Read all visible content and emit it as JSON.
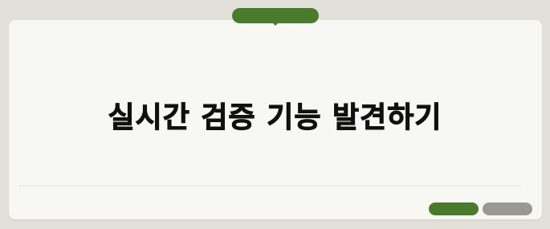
{
  "title": "실시간 검증 기능 발견하기",
  "colors": {
    "background": "#e2e1d9",
    "card": "#f7f7f4",
    "accent_green": "#4a7a2c",
    "muted_gray": "#999893",
    "text": "#111111"
  }
}
